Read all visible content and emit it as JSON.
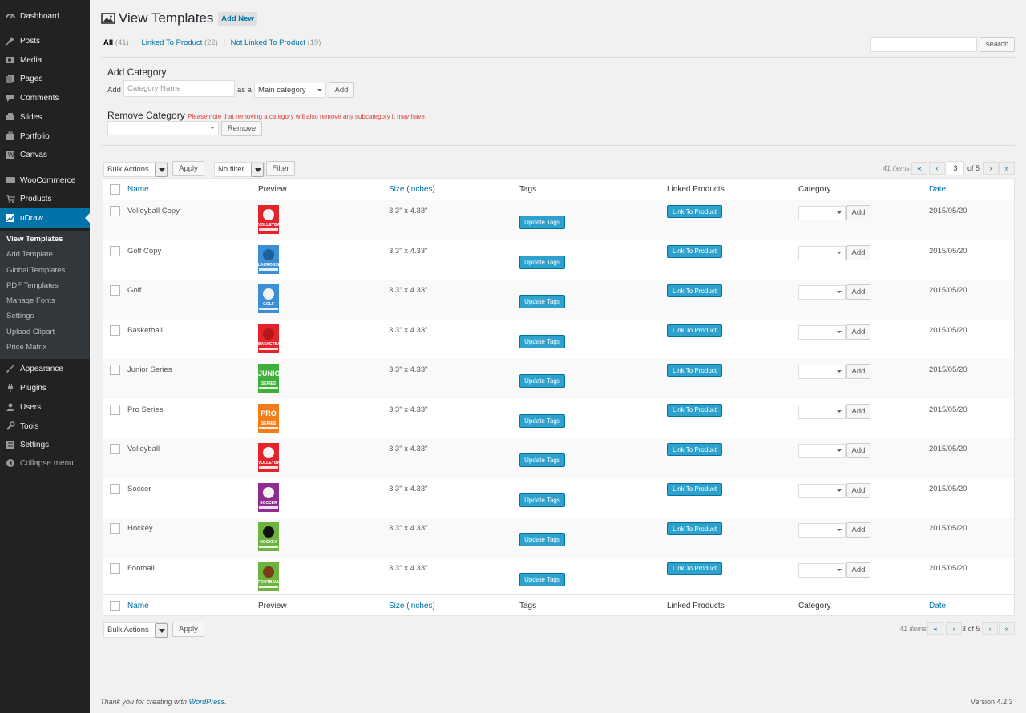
{
  "sidebar": {
    "items": [
      {
        "label": "Dashboard",
        "icon": "dashboard-icon"
      },
      {
        "label": "Posts",
        "icon": "pin-icon"
      },
      {
        "label": "Media",
        "icon": "media-icon"
      },
      {
        "label": "Pages",
        "icon": "pages-icon"
      },
      {
        "label": "Comments",
        "icon": "comments-icon"
      },
      {
        "label": "Slides",
        "icon": "slides-icon"
      },
      {
        "label": "Portfolio",
        "icon": "portfolio-icon"
      },
      {
        "label": "Canvas",
        "icon": "canvas-icon"
      },
      {
        "label": "WooCommerce",
        "icon": "woocommerce-icon"
      },
      {
        "label": "Products",
        "icon": "cart-icon"
      },
      {
        "label": "uDraw",
        "icon": "udraw-icon"
      },
      {
        "label": "Appearance",
        "icon": "brush-icon"
      },
      {
        "label": "Plugins",
        "icon": "plug-icon"
      },
      {
        "label": "Users",
        "icon": "users-icon"
      },
      {
        "label": "Tools",
        "icon": "wrench-icon"
      },
      {
        "label": "Settings",
        "icon": "sliders-icon"
      }
    ],
    "submenu": [
      "View Templates",
      "Add Template",
      "Global Templates",
      "PDF Templates",
      "Manage Fonts",
      "Settings",
      "Upload Clipart",
      "Price Matrix"
    ],
    "collapse": "Collapse menu"
  },
  "header": {
    "title": "View Templates",
    "add_new": "Add New"
  },
  "filters": {
    "all": "All",
    "all_count": "(41)",
    "linked": "Linked To Product",
    "linked_count": "(22)",
    "not_linked": "Not Linked To Product",
    "not_linked_count": "(19)",
    "sep": "|"
  },
  "search": {
    "button": "search",
    "value": ""
  },
  "add_category": {
    "title": "Add Category",
    "add_label": "Add",
    "placeholder": "Category Name",
    "as_a": "as a",
    "parent": "Main category",
    "button": "Add"
  },
  "remove_category": {
    "title": "Remove Category",
    "warning": "Please note that removing a category will also remove any subcategory it may have.",
    "button": "Remove"
  },
  "actions": {
    "bulk": "Bulk Actions",
    "apply": "Apply",
    "filter_select": "No filter",
    "filter_btn": "Filter"
  },
  "pagination": {
    "items": "41 items",
    "current": "3",
    "of_text": "of 5",
    "bottom_text": "3 of 5",
    "first": "«",
    "prev": "‹",
    "next": "›",
    "last": "»"
  },
  "columns": {
    "name": "Name",
    "preview": "Preview",
    "size": "Size (inches)",
    "tags": "Tags",
    "linked": "Linked Products",
    "category": "Category",
    "date": "Date"
  },
  "row_buttons": {
    "update_tags": "Update Tags",
    "link_product": "Link To Product",
    "add": "Add"
  },
  "rows": [
    {
      "name": "Volleyball Copy",
      "size": "3.3\" x 4.33\"",
      "date": "2015/05/20",
      "thumb_label": "VOLLEYBALL",
      "thumb_color": "#e3242b",
      "thumb_ball": "#f2f2f2",
      "thumb_text": ""
    },
    {
      "name": "Golf Copy",
      "size": "3.3\" x 4.33\"",
      "date": "2015/05/20",
      "thumb_label": "LACROSSE",
      "thumb_color": "#3b8fd4",
      "thumb_ball": "#1f5f9a",
      "thumb_text": ""
    },
    {
      "name": "Golf",
      "size": "3.3\" x 4.33\"",
      "date": "2015/05/20",
      "thumb_label": "GOLF",
      "thumb_color": "#3b8fd4",
      "thumb_ball": "#f2f2f2",
      "thumb_text": ""
    },
    {
      "name": "Basketball",
      "size": "3.3\" x 4.33\"",
      "date": "2015/05/20",
      "thumb_label": "BASKETBALL",
      "thumb_color": "#e3242b",
      "thumb_ball": "#b5161b",
      "thumb_text": ""
    },
    {
      "name": "Junior Series",
      "size": "3.3\" x 4.33\"",
      "date": "2015/05/20",
      "thumb_label": "SERIES",
      "thumb_color": "#3fae3a",
      "thumb_ball": "",
      "thumb_text": "JUNIOR"
    },
    {
      "name": "Pro Series",
      "size": "3.3\" x 4.33\"",
      "date": "2015/05/20",
      "thumb_label": "SERIES",
      "thumb_color": "#f07c1a",
      "thumb_ball": "",
      "thumb_text": "PRO"
    },
    {
      "name": "Volleyball",
      "size": "3.3\" x 4.33\"",
      "date": "2015/05/20",
      "thumb_label": "VOLLEYBALL",
      "thumb_color": "#e3242b",
      "thumb_ball": "#f2f2f2",
      "thumb_text": ""
    },
    {
      "name": "Soccer",
      "size": "3.3\" x 4.33\"",
      "date": "2015/05/20",
      "thumb_label": "SOCCER",
      "thumb_color": "#8e2c8f",
      "thumb_ball": "#f2f2f2",
      "thumb_text": ""
    },
    {
      "name": "Hockey",
      "size": "3.3\" x 4.33\"",
      "date": "2015/05/20",
      "thumb_label": "HOCKEY",
      "thumb_color": "#6db33f",
      "thumb_ball": "#111111",
      "thumb_text": ""
    },
    {
      "name": "Football",
      "size": "3.3\" x 4.33\"",
      "date": "2015/05/20",
      "thumb_label": "FOOTBALL",
      "thumb_color": "#6db33f",
      "thumb_ball": "#7a3b1b",
      "thumb_text": ""
    }
  ],
  "footer": {
    "thanks": "Thank you for creating with",
    "wp": "WordPress.",
    "version": "Version 4.2.3"
  }
}
